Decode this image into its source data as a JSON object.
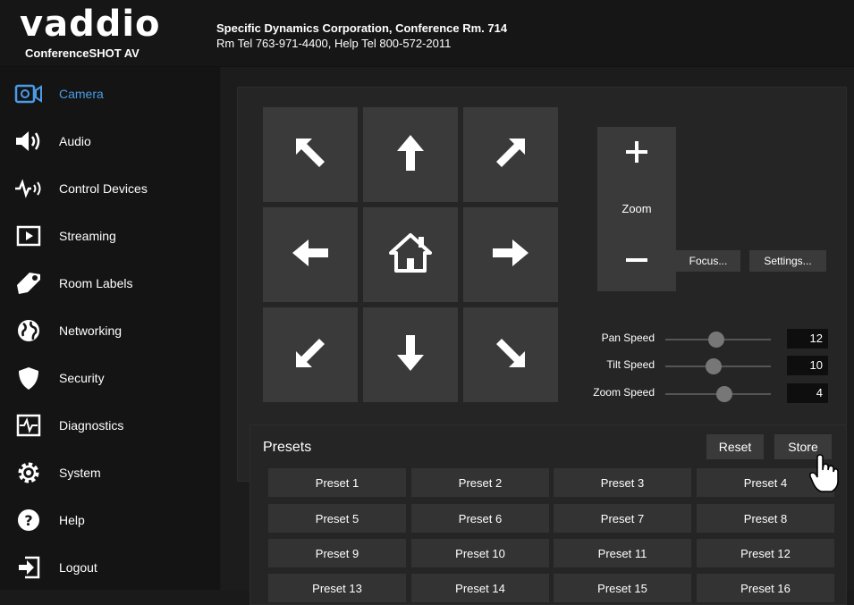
{
  "header": {
    "logo_text": "vaddio",
    "product": "ConferenceSHOT AV",
    "room_line1": "Specific Dynamics Corporation, Conference Rm. 714",
    "room_line2": "Rm Tel 763-971-4400, Help Tel 800-572-2011"
  },
  "sidebar": {
    "items": [
      {
        "label": "Camera",
        "icon": "camera-icon",
        "active": true
      },
      {
        "label": "Audio",
        "icon": "speaker-icon",
        "active": false
      },
      {
        "label": "Control Devices",
        "icon": "control-devices-icon",
        "active": false
      },
      {
        "label": "Streaming",
        "icon": "play-icon",
        "active": false
      },
      {
        "label": "Room Labels",
        "icon": "tag-icon",
        "active": false
      },
      {
        "label": "Networking",
        "icon": "globe-icon",
        "active": false
      },
      {
        "label": "Security",
        "icon": "shield-icon",
        "active": false
      },
      {
        "label": "Diagnostics",
        "icon": "pulse-icon",
        "active": false
      },
      {
        "label": "System",
        "icon": "gear-icon",
        "active": false
      },
      {
        "label": "Help",
        "icon": "question-icon",
        "active": false
      },
      {
        "label": "Logout",
        "icon": "logout-icon",
        "active": false
      }
    ],
    "active_color": "#4a9be8"
  },
  "camera": {
    "ptz_icons": [
      "arrow-up-left-icon",
      "arrow-up-icon",
      "arrow-up-right-icon",
      "arrow-left-icon",
      "home-icon",
      "arrow-right-icon",
      "arrow-down-left-icon",
      "arrow-down-icon",
      "arrow-down-right-icon"
    ],
    "zoom_label": "Zoom",
    "focus_label": "Focus...",
    "settings_label": "Settings...",
    "speeds": [
      {
        "label": "Pan Speed",
        "value": "12",
        "level": 0.48
      },
      {
        "label": "Tilt Speed",
        "value": "10",
        "level": 0.46
      },
      {
        "label": "Zoom Speed",
        "value": "4",
        "level": 0.56
      }
    ]
  },
  "presets": {
    "title": "Presets",
    "reset_label": "Reset",
    "store_label": "Store",
    "items": [
      "Preset 1",
      "Preset 2",
      "Preset 3",
      "Preset 4",
      "Preset 5",
      "Preset 6",
      "Preset 7",
      "Preset 8",
      "Preset 9",
      "Preset 10",
      "Preset 11",
      "Preset 12",
      "Preset 13",
      "Preset 14",
      "Preset 15",
      "Preset 16"
    ]
  }
}
